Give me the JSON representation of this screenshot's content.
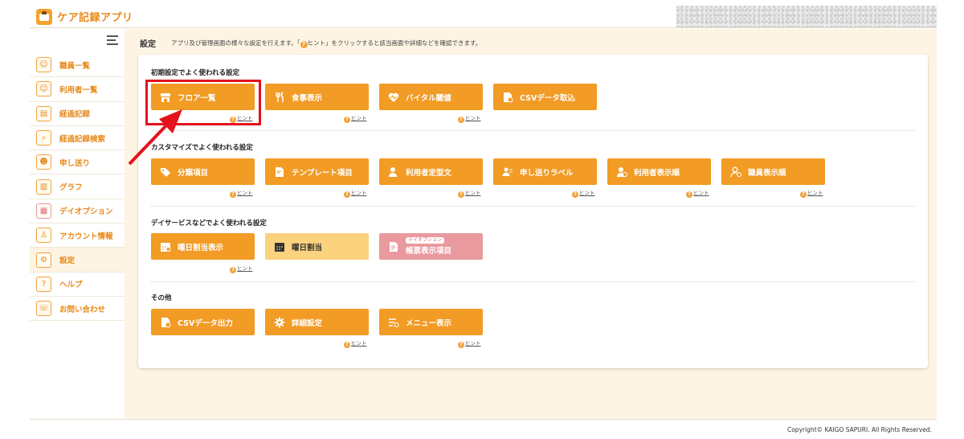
{
  "header": {
    "app_title": "ケア記録アプリ"
  },
  "sidebar": {
    "items": [
      {
        "label": "職員一覧",
        "icon": "staff-icon",
        "active": false
      },
      {
        "label": "利用者一覧",
        "icon": "user-list-icon",
        "active": false
      },
      {
        "label": "経過記録",
        "icon": "record-icon",
        "active": false
      },
      {
        "label": "経過記録検索",
        "icon": "record-search-icon",
        "active": false
      },
      {
        "label": "申し送り",
        "icon": "handover-icon",
        "active": false
      },
      {
        "label": "グラフ",
        "icon": "graph-icon",
        "active": false
      },
      {
        "label": "デイオプション",
        "icon": "day-option-icon",
        "active": false
      },
      {
        "label": "アカウント情報",
        "icon": "account-icon",
        "active": false
      },
      {
        "label": "設定",
        "icon": "gear-icon",
        "active": true
      },
      {
        "label": "ヘルプ",
        "icon": "help-icon",
        "active": false
      },
      {
        "label": "お問い合わせ",
        "icon": "contact-icon",
        "active": false
      }
    ]
  },
  "main": {
    "title": "設定",
    "desc_before": "アプリ及び管理画面の様々な設定を行えます。「",
    "desc_hint": "ヒント",
    "desc_after": "」をクリックすると該当画面や詳細などを確認できます。",
    "hint_label": "ヒント",
    "sections": [
      {
        "title": "初期設定でよく使われる設定",
        "buttons": [
          {
            "label": "フロア一覧",
            "icon": "floor-icon"
          },
          {
            "label": "食事表示",
            "icon": "meal-icon"
          },
          {
            "label": "バイタル閾値",
            "icon": "vital-icon"
          },
          {
            "label": "CSVデータ取込",
            "icon": "csv-import-icon"
          }
        ]
      },
      {
        "title": "カスタマイズでよく使われる設定",
        "buttons": [
          {
            "label": "分類項目",
            "icon": "tag-icon"
          },
          {
            "label": "テンプレート項目",
            "icon": "template-icon"
          },
          {
            "label": "利用者定型文",
            "icon": "user-phrase-icon"
          },
          {
            "label": "申し送りラベル",
            "icon": "handover-label-icon"
          },
          {
            "label": "利用者表示順",
            "icon": "user-order-icon"
          },
          {
            "label": "職員表示順",
            "icon": "staff-order-icon"
          }
        ]
      },
      {
        "title": "デイサービスなどでよく使われる設定",
        "buttons": [
          {
            "label": "曜日割当表示",
            "icon": "calendar-check-icon"
          },
          {
            "label": "曜日割当",
            "icon": "calendar-icon"
          },
          {
            "label": "帳票表示項目",
            "badge": "デイオプション",
            "icon": "report-icon"
          }
        ]
      },
      {
        "title": "その他",
        "buttons": [
          {
            "label": "CSVデータ出力",
            "icon": "csv-export-icon"
          },
          {
            "label": "詳細設定",
            "icon": "gear-icon"
          },
          {
            "label": "メニュー表示",
            "icon": "menu-check-icon"
          }
        ]
      }
    ]
  },
  "footer": {
    "copyright": "Copyright© KAIGO SAPURI. All Rights Reserved."
  },
  "colors": {
    "accent": "#f29b25",
    "text_accent": "#e8891a",
    "highlight": "#e4121c",
    "background": "#fdf4e3",
    "pink": "#e89a9f",
    "light": "#fbd27e"
  }
}
